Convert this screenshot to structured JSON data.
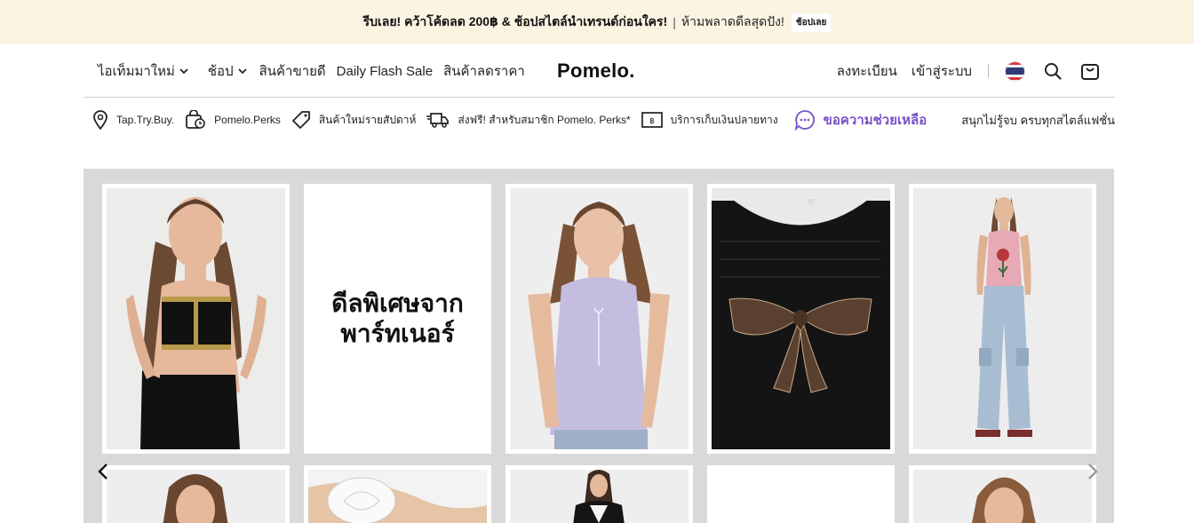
{
  "promo": {
    "headline": "รีบเลย! คว้าโค้ดลด 200฿ & ช้อปสไตล์นำเทรนด์ก่อนใคร!",
    "separator": "|",
    "subline": "ห้ามพลาดดีลสุดปัง!",
    "cta": "ช้อปเลย",
    "bg_color": "#fbf4e2"
  },
  "nav": {
    "items": [
      {
        "label": "ไอเท็มมาใหม่",
        "has_dropdown": true
      },
      {
        "label": "ช้อป",
        "has_dropdown": true
      },
      {
        "label": "สินค้าขายดี",
        "has_dropdown": false
      },
      {
        "label": "Daily Flash Sale",
        "has_dropdown": false
      },
      {
        "label": "สินค้าลดราคา",
        "has_dropdown": false
      }
    ],
    "logo": "Pomelo.",
    "register": "ลงทะเบียน",
    "login": "เข้าสู่ระบบ",
    "flag": "thailand-flag",
    "search_icon": "search-icon",
    "cart_icon": "shopping-bag-icon"
  },
  "usp": {
    "items": [
      {
        "icon": "location-pin-icon",
        "label": "Tap.Try.Buy."
      },
      {
        "icon": "perks-bag-icon",
        "label": "Pomelo.Perks"
      },
      {
        "icon": "tag-icon",
        "label": "สินค้าใหม่รายสัปดาห์"
      },
      {
        "icon": "delivery-truck-icon",
        "label": "ส่งฟรี! สำหรับสมาชิก Pomelo. Perks*"
      },
      {
        "icon": "cash-on-delivery-icon",
        "label": "บริการเก็บเงินปลายทาง"
      }
    ],
    "help_icon": "chat-bubble-icon",
    "help_label": "ขอความช่วยเหลือ",
    "tagline": "สนุกไม่รู้จบ ครบทุกสไตล์แฟชั่น",
    "help_color": "#7552c8"
  },
  "carousel": {
    "promo_card_lines": [
      "ดีลพิเศษจาก",
      "พาร์ทเนอร์"
    ],
    "bg_color": "#d9d9d9",
    "prev_icon": "chevron-left-icon",
    "next_icon": "chevron-right-icon"
  }
}
